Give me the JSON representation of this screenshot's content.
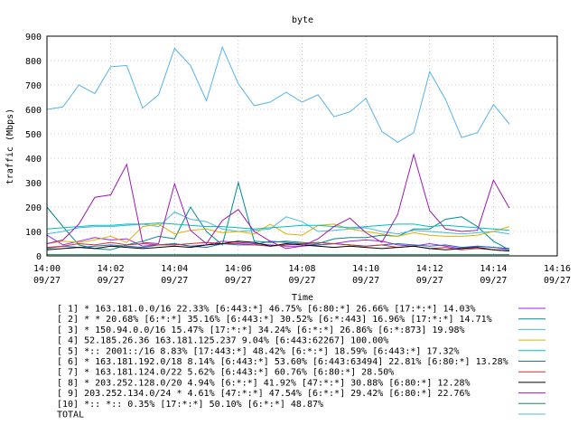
{
  "chart_data": {
    "type": "line",
    "title": "byte",
    "xlabel": "Time",
    "ylabel": "traffic (Mbps)",
    "ylim": [
      0,
      900
    ],
    "yticks": [
      0,
      100,
      200,
      300,
      400,
      500,
      600,
      700,
      800,
      900
    ],
    "xrange_minutes": [
      0,
      16
    ],
    "xticks": [
      {
        "t": 0,
        "time": "14:00",
        "date": "09/27"
      },
      {
        "t": 2,
        "time": "14:02",
        "date": "09/27"
      },
      {
        "t": 4,
        "time": "14:04",
        "date": "09/27"
      },
      {
        "t": 6,
        "time": "14:06",
        "date": "09/27"
      },
      {
        "t": 8,
        "time": "14:08",
        "date": "09/27"
      },
      {
        "t": 10,
        "time": "14:10",
        "date": "09/27"
      },
      {
        "t": 12,
        "time": "14:12",
        "date": "09/27"
      },
      {
        "t": 14,
        "time": "14:14",
        "date": "09/27"
      },
      {
        "t": 16,
        "time": "14:16",
        "date": "09/27"
      }
    ],
    "x": [
      0,
      0.5,
      1,
      1.5,
      2,
      2.5,
      3,
      3.5,
      4,
      4.5,
      5,
      5.5,
      6,
      6.5,
      7,
      7.5,
      8,
      8.5,
      9,
      9.5,
      10,
      10.5,
      11,
      11.5,
      12,
      12.5,
      13,
      13.5,
      14,
      14.5
    ],
    "series": [
      {
        "name": "[ 1] * 163.181.0.0/16 22.33% [6:443:*] 46.75% [6:80:*] 26.66% [17:*:*] 14.03%",
        "color": "#a020f0",
        "values": [
          85,
          45,
          60,
          75,
          65,
          70,
          40,
          45,
          50,
          40,
          45,
          60,
          55,
          50,
          45,
          40,
          40,
          45,
          50,
          60,
          65,
          60,
          45,
          40,
          50,
          40,
          30,
          40,
          35,
          25
        ]
      },
      {
        "name": "[ 2] * * 20.68% [6:*:*] 35.16% [6:443:*] 30.52% [6:*:443] 16.96% [17:*:*] 14.71%",
        "color": "#008b8b",
        "values": [
          200,
          120,
          45,
          30,
          25,
          45,
          60,
          80,
          70,
          200,
          100,
          45,
          300,
          60,
          55,
          60,
          55,
          50,
          70,
          75,
          75,
          85,
          80,
          110,
          110,
          150,
          160,
          120,
          60,
          25
        ]
      },
      {
        "name": "[ 3] * 150.94.0.0/16 15.47% [17:*:*] 34.24% [6:*:*] 26.86% [6:*:873] 19.98%",
        "color": "#4cb8e0",
        "values": [
          90,
          100,
          115,
          120,
          120,
          125,
          130,
          120,
          180,
          150,
          140,
          110,
          100,
          105,
          110,
          160,
          140,
          100,
          105,
          110,
          115,
          100,
          90,
          105,
          100,
          95,
          90,
          95,
          100,
          90
        ]
      },
      {
        "name": "[ 4] 52.185.26.36 163.181.125.237 9.04% [6:443:62267] 100.00%",
        "color": "#e0b000",
        "values": [
          50,
          60,
          55,
          65,
          80,
          55,
          120,
          130,
          90,
          105,
          110,
          95,
          100,
          90,
          130,
          90,
          85,
          125,
          130,
          110,
          100,
          90,
          80,
          95,
          85,
          80,
          80,
          85,
          100,
          120
        ]
      },
      {
        "name": "[ 5] *:: 2001::/16 8.83% [17:443:*] 48.42% [6:*:*] 18.59% [6:443:*] 17.32%",
        "color": "#00bfbf",
        "values": [
          110,
          115,
          120,
          125,
          125,
          130,
          130,
          135,
          130,
          125,
          120,
          120,
          115,
          110,
          115,
          120,
          125,
          125,
          120,
          115,
          120,
          125,
          130,
          130,
          120,
          125,
          120,
          115,
          110,
          105
        ]
      },
      {
        "name": "[ 6] * 163.181.192.0/18 8.14% [6:443:*] 53.60% [6:443:63494] 22.81% [6:80:*] 13.28%",
        "color": "#1e6eb4",
        "values": [
          30,
          40,
          35,
          40,
          45,
          40,
          35,
          45,
          50,
          40,
          35,
          50,
          45,
          45,
          60,
          55,
          50,
          45,
          50,
          45,
          40,
          45,
          50,
          45,
          40,
          45,
          35,
          40,
          35,
          30
        ]
      },
      {
        "name": "[ 7] * 163.181.124.0/22 5.62% [6:443:*] 60.76% [6:80:*] 28.50%",
        "color": "#d03030",
        "values": [
          35,
          40,
          50,
          45,
          55,
          45,
          50,
          45,
          45,
          50,
          55,
          50,
          50,
          45,
          40,
          45,
          50,
          55,
          50,
          45,
          40,
          45,
          35,
          40,
          30,
          35,
          25,
          30,
          25,
          20
        ]
      },
      {
        "name": "[ 8] * 203.252.128.0/20 4.94% [6:*:*] 41.92% [47:*:*] 30.88% [6:80:*] 12.28%",
        "color": "#000000",
        "values": [
          25,
          30,
          35,
          30,
          40,
          35,
          30,
          35,
          40,
          35,
          45,
          50,
          60,
          55,
          40,
          50,
          45,
          40,
          35,
          40,
          35,
          30,
          35,
          40,
          30,
          25,
          30,
          35,
          25,
          20
        ]
      },
      {
        "name": "[ 9] 203.252.134.0/24 * 4.61% [47:*:*] 47.54% [6:*:*] 29.42% [6:80:*] 22.76%",
        "color": "#9a1ab0",
        "values": [
          50,
          65,
          130,
          240,
          250,
          375,
          55,
          50,
          295,
          105,
          50,
          145,
          190,
          100,
          60,
          30,
          40,
          70,
          120,
          155,
          95,
          55,
          170,
          415,
          185,
          110,
          100,
          105,
          310,
          195
        ]
      },
      {
        "name": "[10] *:: *:: 0.35% [17:*:*] 50.10% [6:*:*] 48.87%",
        "color": "#1a8a5a",
        "values": [
          5,
          5,
          5,
          5,
          5,
          5,
          5,
          5,
          5,
          5,
          5,
          5,
          5,
          5,
          5,
          5,
          5,
          5,
          5,
          5,
          5,
          5,
          5,
          5,
          5,
          5,
          5,
          5,
          5,
          5
        ]
      },
      {
        "name": "TOTAL",
        "color": "#56b4e9",
        "values": [
          600,
          610,
          700,
          665,
          775,
          780,
          605,
          660,
          850,
          780,
          635,
          855,
          705,
          615,
          630,
          670,
          630,
          660,
          570,
          590,
          645,
          510,
          465,
          505,
          755,
          640,
          485,
          505,
          620,
          540
        ]
      }
    ]
  }
}
